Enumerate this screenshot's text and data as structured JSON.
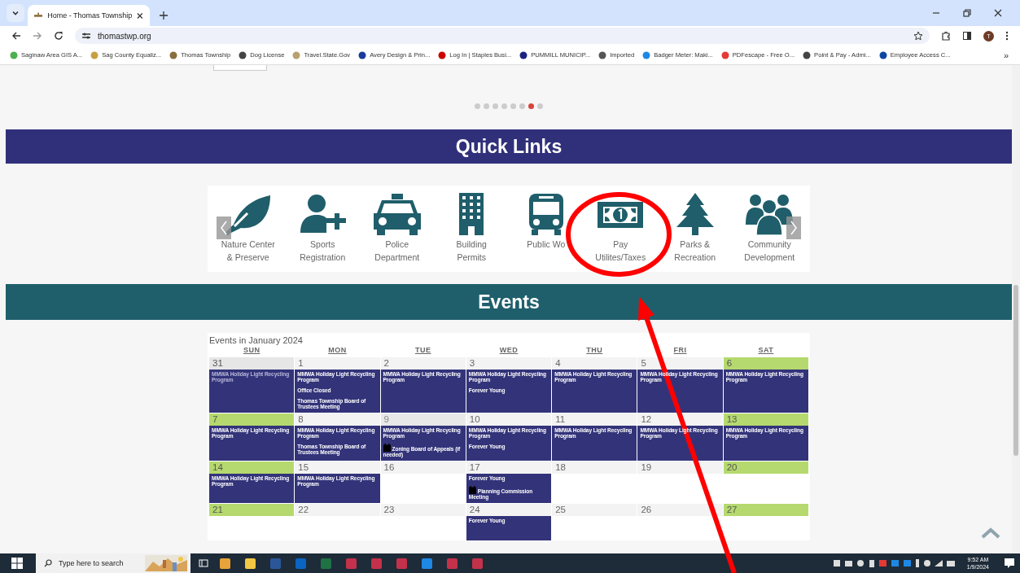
{
  "browser": {
    "tab": {
      "title": "Home - Thomas Township"
    },
    "url": "thomastwp.org",
    "profile_initial": "T",
    "bookmarks": [
      {
        "label": "Saginaw Area GIS A...",
        "color": "#4caf50"
      },
      {
        "label": "Sag County Equaliz...",
        "color": "#c8a040"
      },
      {
        "label": "Thomas Township",
        "color": "#8a6d3b"
      },
      {
        "label": "Dog License",
        "color": "#444444"
      },
      {
        "label": "Travel.State.Gov",
        "color": "#b8a070"
      },
      {
        "label": "Avery Design & Prin...",
        "color": "#1a3a9c"
      },
      {
        "label": "Log In | Staples Busi...",
        "color": "#cc0000"
      },
      {
        "label": "PUMMILL MUNICIP...",
        "color": "#1a237e"
      },
      {
        "label": "Imported",
        "color": "#555555"
      },
      {
        "label": "Badger Meter: Maki...",
        "color": "#1e88e5"
      },
      {
        "label": "PDFescape - Free O...",
        "color": "#e53935"
      },
      {
        "label": "Point & Pay - Admi...",
        "color": "#444444"
      },
      {
        "label": "Employee Access C...",
        "color": "#0d47a1"
      }
    ],
    "more": "»"
  },
  "carousel": {
    "dots": [
      {
        "selected": false
      },
      {
        "selected": false
      },
      {
        "selected": false
      },
      {
        "selected": false
      },
      {
        "selected": false
      },
      {
        "selected": false
      },
      {
        "selected": true
      },
      {
        "selected": false
      }
    ]
  },
  "quick_links": {
    "title": "Quick Links",
    "items": [
      {
        "kind": "leaf",
        "lines": [
          "Nature Center",
          "& Preserve"
        ]
      },
      {
        "kind": "person-plus",
        "lines": [
          "Sports",
          "Registration"
        ]
      },
      {
        "kind": "car",
        "lines": [
          "Police",
          "Department"
        ]
      },
      {
        "kind": "building",
        "lines": [
          "Building",
          "Permits"
        ]
      },
      {
        "kind": "bus",
        "lines": [
          "Public Wo"
        ]
      },
      {
        "kind": "money",
        "lines": [
          "Pay",
          "Utilites/Taxes"
        ]
      },
      {
        "kind": "tree",
        "lines": [
          "Parks &",
          "Recreation"
        ]
      },
      {
        "kind": "people",
        "lines": [
          "Community",
          "Development"
        ]
      }
    ]
  },
  "events": {
    "title": "Events",
    "calendar_title": "Events in January 2024",
    "weekdays": [
      "SUN",
      "MON",
      "TUE",
      "WED",
      "THU",
      "FRI",
      "SAT"
    ],
    "weeks": [
      [
        {
          "day": "31",
          "kind": "other",
          "events": [
            {
              "title": "MMWA Holiday Light Recycling Program"
            }
          ]
        },
        {
          "day": "1",
          "kind": "weekday",
          "events": [
            {
              "title": "MMWA Holiday Light Recycling Program"
            },
            {
              "title": "Office Closed"
            },
            {
              "title": "Thomas Township Board of Trustees Meeting"
            }
          ]
        },
        {
          "day": "2",
          "kind": "weekday",
          "events": [
            {
              "title": "MMWA Holiday Light Recycling Program"
            }
          ]
        },
        {
          "day": "3",
          "kind": "weekday",
          "events": [
            {
              "title": "MMWA Holiday Light Recycling Program"
            },
            {
              "title": "Forever Young"
            }
          ]
        },
        {
          "day": "4",
          "kind": "weekday",
          "events": [
            {
              "title": "MMWA Holiday Light Recycling Program"
            }
          ]
        },
        {
          "day": "5",
          "kind": "weekday",
          "events": [
            {
              "title": "MMWA Holiday Light Recycling Program"
            }
          ]
        },
        {
          "day": "6",
          "kind": "weekend",
          "events": [
            {
              "title": "MMWA Holiday Light Recycling Program"
            }
          ]
        }
      ],
      [
        {
          "day": "7",
          "kind": "weekend",
          "events": [
            {
              "title": "MMWA Holiday Light Recycling Program"
            }
          ]
        },
        {
          "day": "8",
          "kind": "weekday",
          "events": [
            {
              "title": "MMWA Holiday Light Recycling Program"
            },
            {
              "title": "Thomas Township Board of Trustees Meeting"
            }
          ]
        },
        {
          "day": "9",
          "kind": "today",
          "events": [
            {
              "title": "MMWA Holiday Light Recycling Program"
            },
            {
              "title": "Zoning Board of Appeals (if needed)",
              "icon": true
            }
          ]
        },
        {
          "day": "10",
          "kind": "weekday",
          "events": [
            {
              "title": "MMWA Holiday Light Recycling Program"
            },
            {
              "title": "Forever Young"
            }
          ]
        },
        {
          "day": "11",
          "kind": "weekday",
          "events": [
            {
              "title": "MMWA Holiday Light Recycling Program"
            }
          ]
        },
        {
          "day": "12",
          "kind": "weekday",
          "events": [
            {
              "title": "MMWA Holiday Light Recycling Program"
            }
          ]
        },
        {
          "day": "13",
          "kind": "weekend",
          "events": [
            {
              "title": "MMWA Holiday Light Recycling Program"
            }
          ]
        }
      ],
      [
        {
          "day": "14",
          "kind": "weekend",
          "events": [
            {
              "title": "MMWA Holiday Light Recycling Program"
            }
          ]
        },
        {
          "day": "15",
          "kind": "weekday",
          "events": [
            {
              "title": "MMWA Holiday Light Recycling Program"
            }
          ]
        },
        {
          "day": "16",
          "kind": "weekday"
        },
        {
          "day": "17",
          "kind": "weekday",
          "events": [
            {
              "title": "Forever Young"
            },
            {
              "title": "Planning Commission Meeting",
              "icon": true
            }
          ]
        },
        {
          "day": "18",
          "kind": "weekday"
        },
        {
          "day": "19",
          "kind": "weekday"
        },
        {
          "day": "20",
          "kind": "weekend"
        }
      ],
      [
        {
          "day": "21",
          "kind": "weekend"
        },
        {
          "day": "22",
          "kind": "weekday"
        },
        {
          "day": "23",
          "kind": "weekday"
        },
        {
          "day": "24",
          "kind": "weekday",
          "events": [
            {
              "title": "Forever Young"
            }
          ]
        },
        {
          "day": "25",
          "kind": "weekday"
        },
        {
          "day": "26",
          "kind": "weekday"
        },
        {
          "day": "27",
          "kind": "weekend"
        }
      ]
    ]
  },
  "taskbar": {
    "search_placeholder": "Type here to search",
    "apps": [
      {
        "color": "#e8a33a"
      },
      {
        "color": "#f2c744"
      },
      {
        "color": "#2b579a"
      },
      {
        "color": "#0a64c2"
      },
      {
        "color": "#1f7244"
      },
      {
        "color": "#c4314b"
      },
      {
        "color": "#c4314b"
      },
      {
        "color": "#c4314b"
      },
      {
        "color": "#1e88e5"
      },
      {
        "color": "#c4314b"
      },
      {
        "color": "#c4314b"
      }
    ],
    "time": "9:52 AM",
    "date": "1/9/2024"
  }
}
